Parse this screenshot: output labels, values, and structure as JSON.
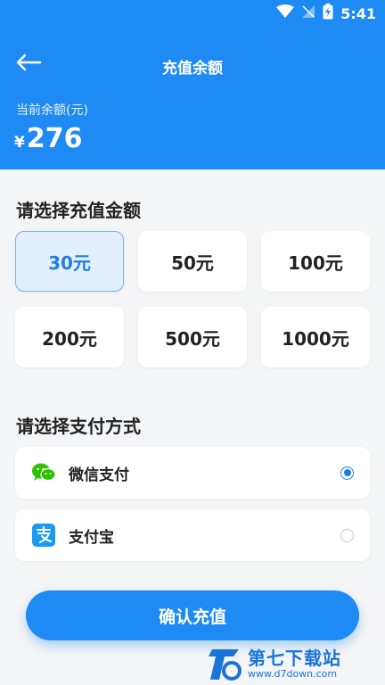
{
  "status_bar": {
    "time": "5:41"
  },
  "header": {
    "title": "充值余额",
    "balance_label": "当前余额(元)",
    "currency_symbol": "¥",
    "balance": "276"
  },
  "amount_section": {
    "title": "请选择充值金额",
    "options": [
      "30元",
      "50元",
      "100元",
      "200元",
      "500元",
      "1000元"
    ],
    "selected": "30元"
  },
  "payment_section": {
    "title": "请选择支付方式",
    "methods": [
      {
        "label": "微信支付",
        "icon": "wechat-icon",
        "selected": true
      },
      {
        "label": "支付宝",
        "icon": "alipay-icon",
        "selected": false
      }
    ]
  },
  "confirm_label": "确认充值",
  "watermark": {
    "name": "第七下载站",
    "url": "www.d7down.com"
  },
  "colors": {
    "primary": "#1e8af3",
    "selected_bg": "#e3effd",
    "wechat": "#2dc100",
    "alipay": "#1a9bf0"
  }
}
